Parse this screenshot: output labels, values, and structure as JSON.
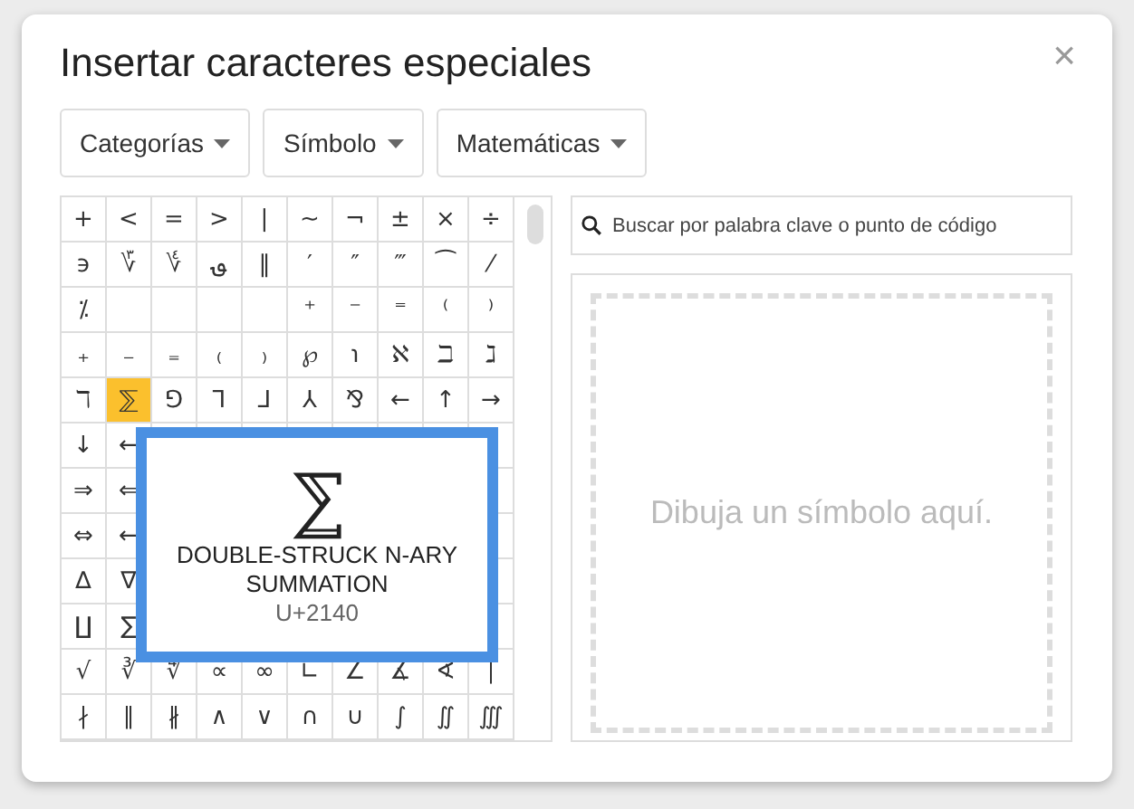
{
  "dialog": {
    "title": "Insertar caracteres especiales",
    "close": "×"
  },
  "dropdowns": [
    {
      "label": "Categorías"
    },
    {
      "label": "Símbolo"
    },
    {
      "label": "Matemáticas"
    }
  ],
  "grid": {
    "rows": [
      [
        {
          "c": "+",
          "selected": false
        },
        {
          "c": "<",
          "selected": false
        },
        {
          "c": "=",
          "selected": false
        },
        {
          "c": ">",
          "selected": false
        },
        {
          "c": "|",
          "selected": false
        },
        {
          "c": "∼",
          "selected": false
        },
        {
          "c": "¬",
          "selected": false
        },
        {
          "c": "±",
          "selected": false
        },
        {
          "c": "×",
          "selected": false
        },
        {
          "c": "÷",
          "selected": false
        }
      ],
      [
        {
          "c": "϶",
          "selected": false
        },
        {
          "c": "؆",
          "selected": false
        },
        {
          "c": "؇",
          "selected": false
        },
        {
          "c": "؈",
          "selected": false
        },
        {
          "c": "‖",
          "selected": false
        },
        {
          "c": "′",
          "selected": false
        },
        {
          "c": "″",
          "selected": false
        },
        {
          "c": "‴",
          "selected": false
        },
        {
          "c": "⁀",
          "selected": false
        },
        {
          "c": "⁄",
          "selected": false
        }
      ],
      [
        {
          "c": "⁒",
          "selected": false
        },
        null,
        null,
        null,
        null,
        {
          "c": "⁺",
          "selected": false
        },
        {
          "c": "⁻",
          "selected": false
        },
        {
          "c": "⁼",
          "selected": false
        },
        {
          "c": "⁽",
          "selected": false
        },
        {
          "c": "⁾",
          "selected": false
        }
      ],
      [
        {
          "c": "₊",
          "selected": false
        },
        {
          "c": "₋",
          "selected": false
        },
        {
          "c": "₌",
          "selected": false
        },
        {
          "c": "₍",
          "selected": false
        },
        {
          "c": "₎",
          "selected": false
        },
        {
          "c": "℘",
          "selected": false
        },
        {
          "c": "℩",
          "selected": false
        },
        {
          "c": "ℵ",
          "selected": false
        },
        {
          "c": "ℶ",
          "selected": false
        },
        {
          "c": "ℷ",
          "selected": false
        }
      ],
      [
        {
          "c": "ℸ",
          "selected": false
        },
        {
          "c": "⅀",
          "selected": true
        },
        {
          "c": "⅁",
          "selected": false
        },
        {
          "c": "⅂",
          "selected": false
        },
        {
          "c": "⅃",
          "selected": false
        },
        {
          "c": "⅄",
          "selected": false
        },
        {
          "c": "⅋",
          "selected": false
        },
        {
          "c": "←",
          "selected": false
        },
        {
          "c": "↑",
          "selected": false
        },
        {
          "c": "→",
          "selected": false
        }
      ],
      [
        {
          "c": "↓",
          "selected": false
        },
        {
          "c": "←",
          "selected": false
        }
      ],
      [
        {
          "c": "⇒",
          "selected": false
        },
        {
          "c": "⇐",
          "selected": false
        }
      ],
      [
        {
          "c": "⇔",
          "selected": false
        },
        {
          "c": "←",
          "selected": false
        }
      ],
      [
        {
          "c": "∆",
          "selected": false
        },
        {
          "c": "∇",
          "selected": false
        }
      ],
      [
        {
          "c": "∐",
          "selected": false
        },
        {
          "c": "∑",
          "selected": false
        }
      ],
      [
        {
          "c": "√",
          "selected": false
        },
        {
          "c": "∛",
          "selected": false
        },
        {
          "c": "∜",
          "selected": false
        },
        {
          "c": "∝",
          "selected": false
        },
        {
          "c": "∞",
          "selected": false
        },
        {
          "c": "∟",
          "selected": false
        },
        {
          "c": "∠",
          "selected": false
        },
        {
          "c": "∡",
          "selected": false
        },
        {
          "c": "∢",
          "selected": false
        },
        {
          "c": "∣",
          "selected": false
        }
      ],
      [
        {
          "c": "∤",
          "selected": false
        },
        {
          "c": "∥",
          "selected": false
        },
        {
          "c": "∦",
          "selected": false
        },
        {
          "c": "∧",
          "selected": false
        },
        {
          "c": "∨",
          "selected": false
        },
        {
          "c": "∩",
          "selected": false
        },
        {
          "c": "∪",
          "selected": false
        },
        {
          "c": "∫",
          "selected": false
        },
        {
          "c": "∬",
          "selected": false
        },
        {
          "c": "∭",
          "selected": false
        }
      ]
    ]
  },
  "preview": {
    "glyph": "⅀",
    "name": "DOUBLE-STRUCK N-ARY SUMMATION",
    "code": "U+2140"
  },
  "search": {
    "placeholder": "Buscar por palabra clave o punto de código"
  },
  "draw_area": {
    "hint": "Dibuja un símbolo aquí."
  }
}
